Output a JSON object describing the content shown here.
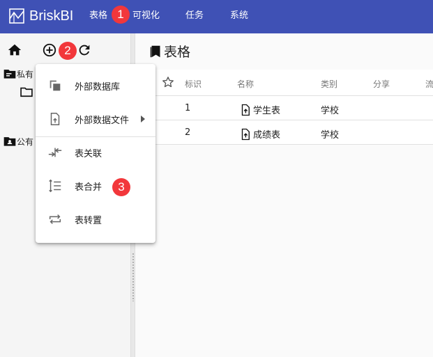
{
  "app": {
    "title": "BriskBI"
  },
  "nav": {
    "items": [
      "表格",
      "可视化",
      "任务",
      "系统"
    ]
  },
  "badges": [
    "1",
    "2",
    "3"
  ],
  "sidebar": {
    "private_label": "私有",
    "public_label": "公有"
  },
  "page": {
    "title": "表格"
  },
  "table": {
    "columns": [
      "标识",
      "名称",
      "类别",
      "分享",
      "流"
    ],
    "rows": [
      {
        "id": "1",
        "name": "学生表",
        "category": "学校"
      },
      {
        "id": "2",
        "name": "成绩表",
        "category": "学校"
      }
    ]
  },
  "menu": {
    "items": [
      {
        "label": "外部数据库",
        "icon": "copy-icon"
      },
      {
        "label": "外部数据文件",
        "icon": "file-upload-icon",
        "has_submenu": true
      },
      {
        "label": "表关联",
        "icon": "merge-arrows-icon"
      },
      {
        "label": "表合并",
        "icon": "vertical-lines-icon"
      },
      {
        "label": "表转置",
        "icon": "swap-arrows-icon"
      }
    ]
  },
  "colors": {
    "topbar": "#3f51b5",
    "badge": "#f2373b"
  }
}
